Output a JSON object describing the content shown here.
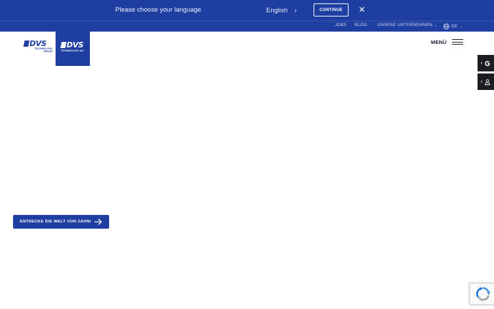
{
  "banner": {
    "prompt": "Please choose your language",
    "language": "English",
    "continue_label": "CONTINUE",
    "close_icon": "close-icon"
  },
  "top_nav": {
    "jobs": "JOBS",
    "blog": "BLOG",
    "companies": "UNSERE UNTERNEHMEN",
    "language": "DE"
  },
  "logos": {
    "group": {
      "word": "DVS",
      "line1": "TECHNOLOGY",
      "line2": "GROUP"
    },
    "ag": {
      "word": "DVS",
      "line1": "TECHNOLOGY AG"
    }
  },
  "header": {
    "menu_label": "MENÜ"
  },
  "side_tabs": [
    {
      "icon": "google-icon"
    },
    {
      "icon": "user-icon"
    }
  ],
  "hero": {
    "cta_label": "ENTDECKE DIE WELT VON ZAHNI"
  },
  "colors": {
    "brand_blue": "#1e3ea1",
    "side_tab_bg": "#1c1c22"
  }
}
